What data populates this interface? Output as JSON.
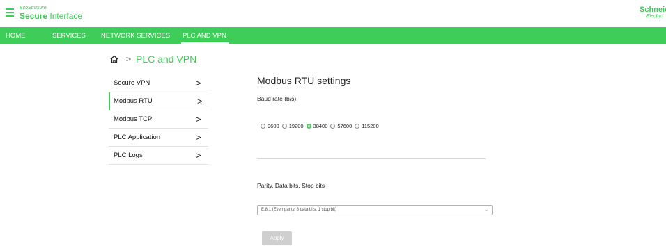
{
  "header": {
    "brand_small": "EcoStruxure",
    "brand_bold": "Secure",
    "brand_rest": " Interface",
    "logo_line1": "Schneider",
    "logo_line2": "Electric"
  },
  "nav": {
    "items": [
      {
        "label": "HOME"
      },
      {
        "label": "SERVICES"
      },
      {
        "label": "NETWORK SERVICES"
      },
      {
        "label": "PLC AND VPN"
      }
    ],
    "active": "PLC AND VPN"
  },
  "breadcrumb": {
    "separator": ">",
    "current": "PLC and VPN"
  },
  "sidemenu": {
    "items": [
      {
        "label": "Secure VPN"
      },
      {
        "label": "Modbus RTU"
      },
      {
        "label": "Modbus TCP"
      },
      {
        "label": "PLC Application"
      },
      {
        "label": "PLC Logs"
      }
    ],
    "active": "Modbus RTU",
    "chevron": ">"
  },
  "content": {
    "title": "Modbus RTU settings",
    "baud_label": "Baud rate (b/s)",
    "baud_options": [
      "9600",
      "19200",
      "38400",
      "57600",
      "115200"
    ],
    "baud_selected": "38400",
    "parity_label": "Parity, Data bits, Stop bits",
    "parity_selected": "E,8,1 (Even parity, 8 data bits, 1 stop bit)",
    "select_caret": "⌄",
    "apply_label": "Apply"
  },
  "colors": {
    "accent": "#3dcd58",
    "button_disabled": "#cfcfcf"
  }
}
